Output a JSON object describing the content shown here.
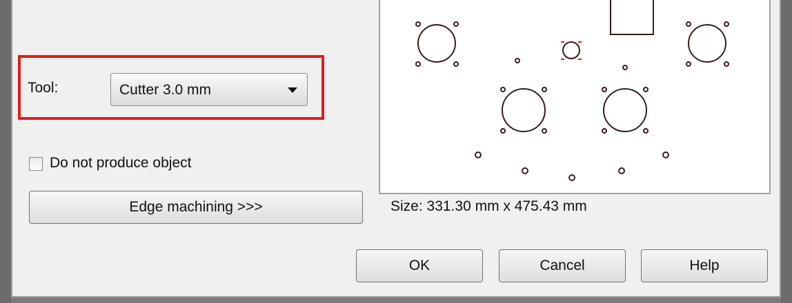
{
  "tool": {
    "label": "Tool:",
    "selected": "Cutter 3.0 mm"
  },
  "checkbox": {
    "label": "Do not produce object",
    "checked": false
  },
  "edge_button_label": "Edge machining >>>",
  "preview": {
    "size_text": "Size:  331.30 mm x 475.43 mm"
  },
  "footer": {
    "ok_label": "OK",
    "cancel_label": "Cancel",
    "help_label": "Help"
  },
  "colors": {
    "highlight": "#e41b1b",
    "drawing": "#3a1a1a"
  }
}
